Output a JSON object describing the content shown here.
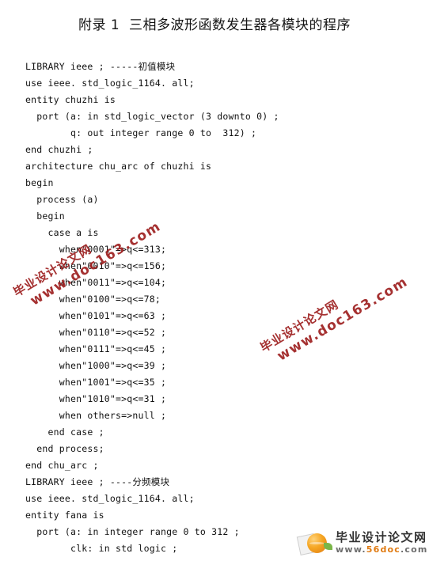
{
  "document": {
    "title": "附录 1  三相多波形函数发生器各模块的程序"
  },
  "code": {
    "lines": [
      "LIBRARY ieee ; -----初值模块",
      "use ieee. std_logic_1164. all;",
      "entity chuzhi is",
      "  port (a: in std_logic_vector (3 downto 0) ;",
      "        q: out integer range 0 to  312) ;",
      "end chuzhi ;",
      "architecture chu_arc of chuzhi is",
      "begin",
      "  process (a)",
      "  begin",
      "    case a is",
      "      when\"0001\"=>q<=313;",
      "      when\"0010\"=>q<=156;",
      "      when\"0011\"=>q<=104;",
      "      when\"0100\"=>q<=78;",
      "      when\"0101\"=>q<=63 ;",
      "      when\"0110\"=>q<=52 ;",
      "      when\"0111\"=>q<=45 ;",
      "      when\"1000\"=>q<=39 ;",
      "      when\"1001\"=>q<=35 ;",
      "      when\"1010\"=>q<=31 ;",
      "      when others=>null ;",
      "    end case ;",
      "  end process;",
      "end chu_arc ;",
      "LIBRARY ieee ; ----分频模块",
      "use ieee. std_logic_1164. all;",
      "entity fana is",
      "  port (a: in integer range 0 to 312 ;",
      "        clk: in std logic ;"
    ]
  },
  "watermarks": {
    "accent_color": "#9e2020",
    "items": [
      {
        "cn": "毕业设计论文网",
        "url": "www.doc163.com"
      },
      {
        "cn": "毕业设计论文网",
        "url": "www.doc163.com"
      }
    ]
  },
  "footer_logo": {
    "site_name": "毕业设计论文网",
    "url_prefix": "www.",
    "url_brand": "56doc",
    "url_suffix": ".com",
    "brand_color": "#e07b12",
    "text_color": "#333333"
  }
}
